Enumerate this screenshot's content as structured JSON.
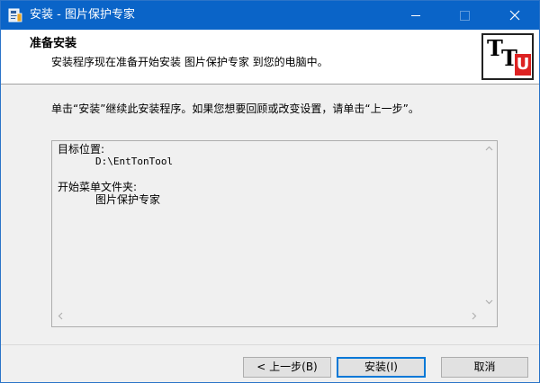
{
  "titlebar": {
    "title": "安装 - 图片保护专家",
    "icon": "installer-icon"
  },
  "header": {
    "title": "准备安装",
    "subtitle": "安装程序现在准备开始安装 图片保护专家 到您的电脑中。",
    "logo_letters": [
      "T",
      "T",
      "U"
    ],
    "logo_accent": "#dd2222"
  },
  "instruction": "单击“安装”继续此安装程序。如果您想要回顾或改变设置，请单击“上一步”。",
  "info": {
    "dest_label": "目标位置:",
    "dest_value": "D:\\EntTonTool",
    "menu_label": "开始菜单文件夹:",
    "menu_value": "图片保护专家"
  },
  "buttons": {
    "back": "< 上一步(B)",
    "install": "安装(I)",
    "cancel": "取消"
  },
  "colors": {
    "titlebar": "#0a64c8",
    "focus_border": "#0078d7"
  }
}
